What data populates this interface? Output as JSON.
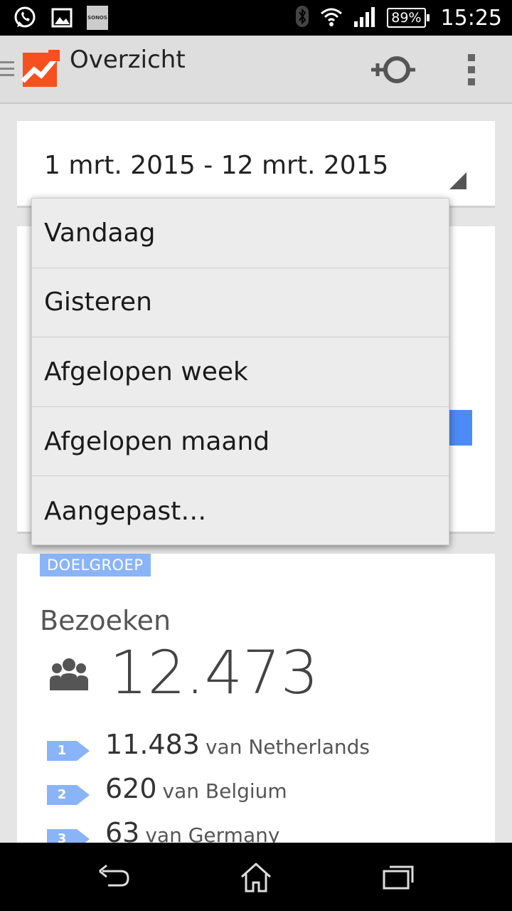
{
  "status_bar": {
    "time": "15:25",
    "battery": "89%",
    "sonos_label": "SONOS"
  },
  "action_bar": {
    "title": "Overzicht"
  },
  "date_selector": {
    "value": "1 mrt. 2015 - 12 mrt. 2015"
  },
  "dropdown": {
    "items": [
      "Vandaag",
      "Gisteren",
      "Afgelopen week",
      "Afgelopen maand",
      "Aangepast…"
    ]
  },
  "audience": {
    "tag": "DOELGROEP",
    "label": "Bezoeken",
    "value": "12.473",
    "ranks": [
      {
        "rank": "1",
        "count": "11.483",
        "text": "van Netherlands"
      },
      {
        "rank": "2",
        "count": "620",
        "text": "van Belgium"
      },
      {
        "rank": "3",
        "count": "63",
        "text": "van Germany"
      }
    ]
  },
  "colors": {
    "accent_blue": "#4c8bf5",
    "tag_blue": "#8ab4f8",
    "logo_orange": "#f4511e"
  },
  "icons": [
    "whatsapp-icon",
    "gallery-icon",
    "sonos-icon",
    "bluetooth-icon",
    "wifi-icon",
    "signal-icon",
    "battery-icon",
    "menu-icon",
    "analytics-logo-icon",
    "add-segment-icon",
    "overflow-menu-icon",
    "people-icon",
    "back-icon",
    "home-icon",
    "recents-icon"
  ]
}
